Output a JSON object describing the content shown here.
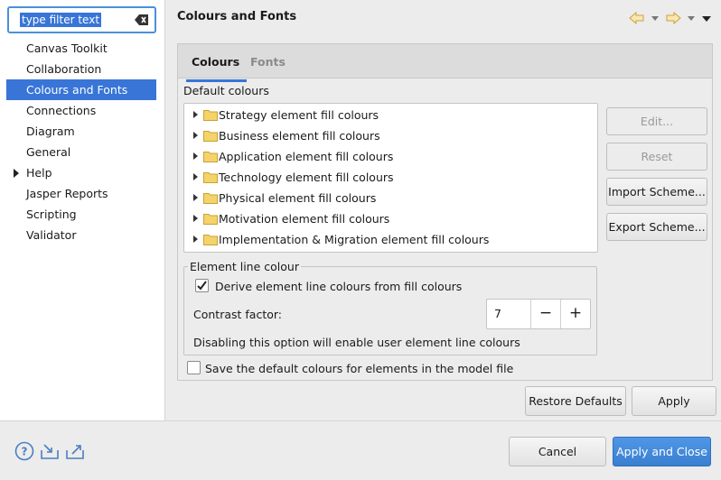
{
  "filter": {
    "placeholder": "type filter text"
  },
  "sidebar": {
    "items": [
      {
        "label": "Canvas Toolkit",
        "selected": false,
        "expandable": false
      },
      {
        "label": "Collaboration",
        "selected": false,
        "expandable": false
      },
      {
        "label": "Colours and Fonts",
        "selected": true,
        "expandable": false
      },
      {
        "label": "Connections",
        "selected": false,
        "expandable": false
      },
      {
        "label": "Diagram",
        "selected": false,
        "expandable": false
      },
      {
        "label": "General",
        "selected": false,
        "expandable": false
      },
      {
        "label": "Help",
        "selected": false,
        "expandable": true
      },
      {
        "label": "Jasper Reports",
        "selected": false,
        "expandable": false
      },
      {
        "label": "Scripting",
        "selected": false,
        "expandable": false
      },
      {
        "label": "Validator",
        "selected": false,
        "expandable": false
      }
    ]
  },
  "header": {
    "title": "Colours and Fonts"
  },
  "tabs": {
    "colours": "Colours",
    "fonts": "Fonts"
  },
  "colours": {
    "default_label": "Default colours",
    "tree_items": [
      "Strategy element fill colours",
      "Business element fill colours",
      "Application element fill colours",
      "Technology element fill colours",
      "Physical element fill colours",
      "Motivation element fill colours",
      "Implementation & Migration element fill colours"
    ],
    "buttons": {
      "edit": "Edit...",
      "reset": "Reset",
      "import": "Import Scheme...",
      "export": "Export Scheme..."
    },
    "line_group": {
      "title": "Element line colour",
      "derive_label": "Derive element line colours from fill colours",
      "derive_checked": true,
      "contrast_label": "Contrast factor:",
      "contrast_value": "7",
      "minus": "−",
      "plus": "+",
      "hint": "Disabling this option will enable user element line colours"
    },
    "save_default_label": "Save the default colours for elements in the model file",
    "save_default_checked": false
  },
  "actions": {
    "restore": "Restore Defaults",
    "apply": "Apply",
    "cancel": "Cancel",
    "apply_close": "Apply and Close"
  },
  "colors": {
    "accent": "#3875d7",
    "primary_button": "#3a7fd0",
    "folder": "#f2c94c"
  }
}
